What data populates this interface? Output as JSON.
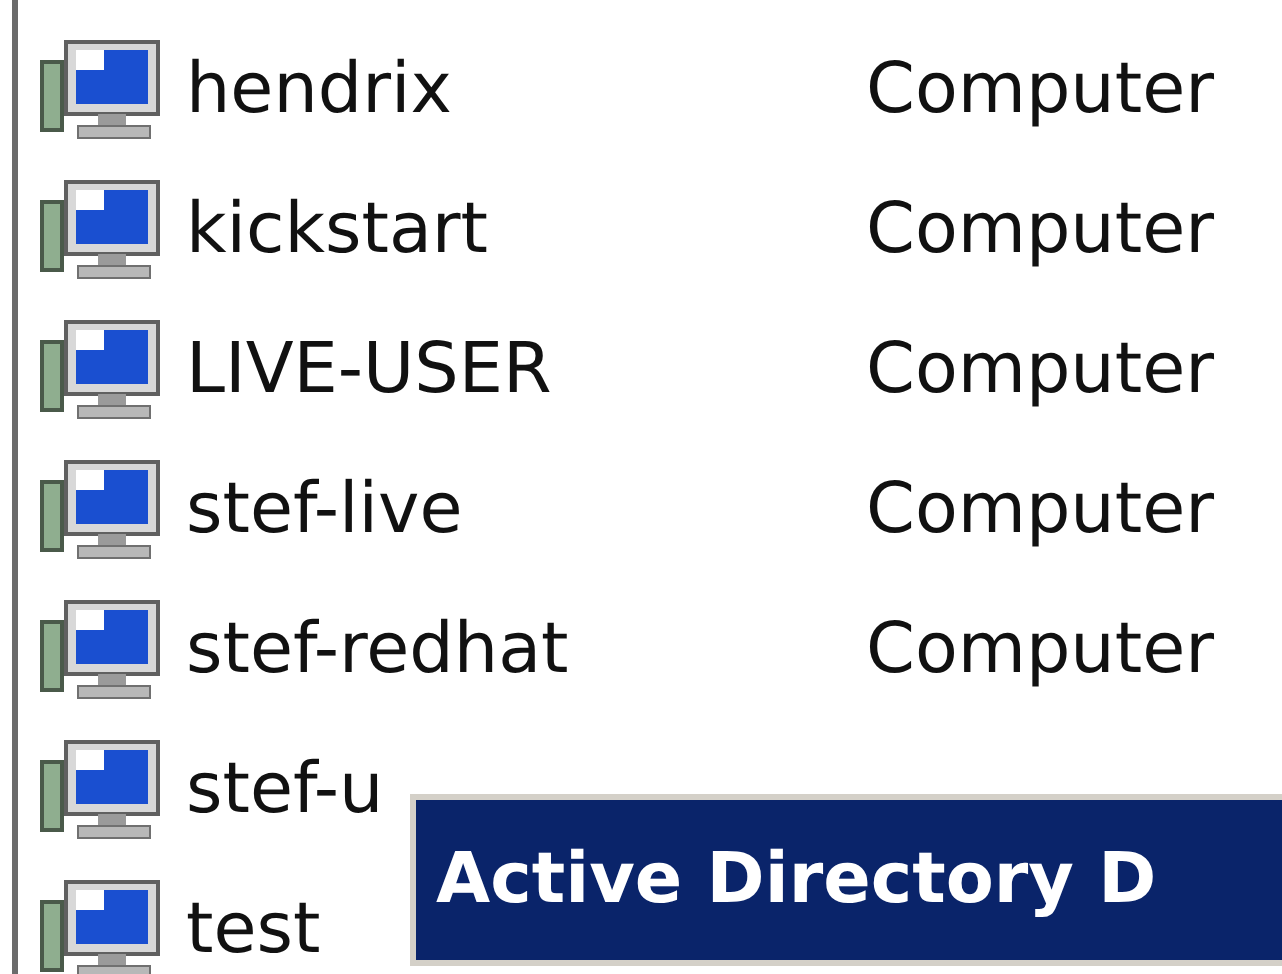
{
  "rows": [
    {
      "name": "hendrix",
      "type": "Computer"
    },
    {
      "name": "kickstart",
      "type": "Computer"
    },
    {
      "name": "LIVE-USER",
      "type": "Computer"
    },
    {
      "name": "stef-live",
      "type": "Computer"
    },
    {
      "name": "stef-redhat",
      "type": "Computer"
    },
    {
      "name": "stef-u"
    },
    {
      "name": "test"
    }
  ],
  "tooltip": {
    "text": "Active Directory D"
  }
}
